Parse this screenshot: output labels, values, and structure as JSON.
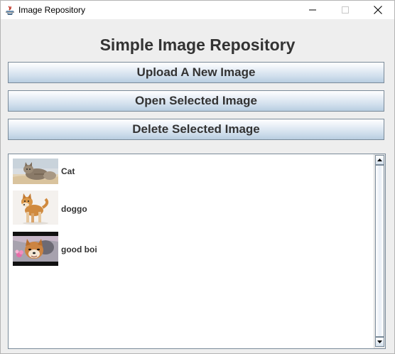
{
  "window": {
    "title": "Image Repository",
    "controls": {
      "minimize": "minimize-icon",
      "maximize": "maximize-icon",
      "close": "close-icon"
    }
  },
  "main": {
    "heading": "Simple Image Repository",
    "buttons": {
      "upload": "Upload A New Image",
      "open": "Open Selected Image",
      "delete": "Delete Selected Image"
    }
  },
  "list": {
    "items": [
      {
        "label": "Cat",
        "thumbnail": "cat-photo"
      },
      {
        "label": "doggo",
        "thumbnail": "shiba-dog-photo"
      },
      {
        "label": "good boi",
        "thumbnail": "shiba-dog-closeup-photo"
      }
    ]
  },
  "colors": {
    "button_gradient_top": "#ffffff",
    "button_gradient_bottom": "#b8cde0",
    "border": "#7a8a99",
    "text": "#333333",
    "window_bg": "#eeeeee"
  }
}
